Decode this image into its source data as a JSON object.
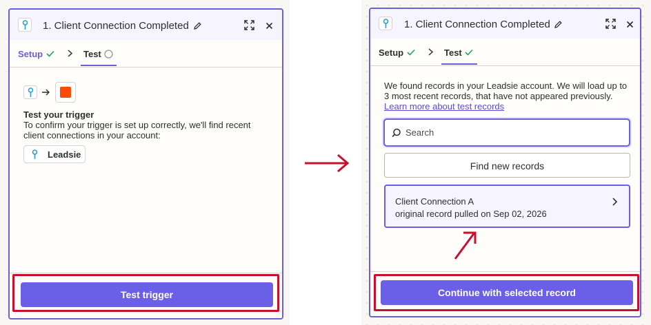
{
  "left_panel": {
    "title": "1. Client Connection Completed",
    "tabs": [
      {
        "label": "Setup",
        "status": "complete"
      },
      {
        "label": "Test",
        "status": "pending"
      }
    ],
    "heading": "Test your trigger",
    "description_lines": [
      "To confirm your trigger is set up correctly, we'll find recent",
      "client connections in your account:"
    ],
    "app_chip_label": "Leadsie",
    "button_label": "Test trigger"
  },
  "right_panel": {
    "title": "1. Client Connection Completed",
    "tabs": [
      {
        "label": "Setup",
        "status": "complete"
      },
      {
        "label": "Test",
        "status": "complete"
      }
    ],
    "info_lines": [
      "We found records in your Leadsie account. We will load up to",
      "3 most recent records, that have not appeared previously."
    ],
    "learn_more_link": "Learn more about test records",
    "search_placeholder": "Search",
    "find_button_label": "Find new records",
    "record": {
      "title": "Client Connection A",
      "subtitle": "original record pulled on Sep 02, 2026"
    },
    "continue_button_label": "Continue with selected record"
  },
  "icons": {
    "app": "leadsie-key-icon",
    "trigger_app": "orange-square-icon",
    "arrow": "arrow-right-icon",
    "edit": "pencil-icon",
    "expand": "expand-icon",
    "close": "close-icon",
    "check": "check-icon",
    "pending": "circle-icon",
    "chevron": "chevron-right-icon",
    "search": "search-icon"
  },
  "colors": {
    "accent": "#6a5fd8",
    "primary_button": "#6a5fe6",
    "highlight_annotation": "#c8102e",
    "success_check": "#22a35a",
    "trigger_app": "#ff4a00"
  }
}
